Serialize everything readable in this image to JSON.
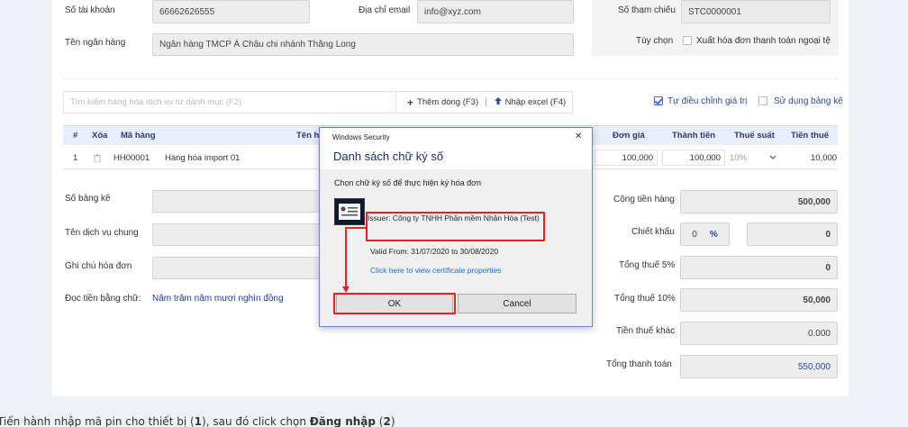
{
  "form": {
    "account_label": "Số tài khoản",
    "account_value": "66662626555",
    "email_label": "Địa chỉ email",
    "email_value": "info@xyz.com",
    "reference_label": "Số tham chiếu",
    "reference_value": "STC0000001",
    "bank_label": "Tên ngân hàng",
    "bank_value": "Ngân hàng TMCP Á Châu chi nhánh Thăng Long",
    "option_label": "Tùy chọn",
    "foreign_invoice_label": "Xuất hóa đơn thanh toán ngoại tệ"
  },
  "toolbar": {
    "search_placeholder": "Tìm kiếm hàng hóa dịch vụ từ danh mục (F2)",
    "add_row_label": "Thêm dòng (F3)",
    "separator": "|",
    "import_excel_label": "Nhập excel (F4)",
    "auto_adjust_label": "Tự điều chỉnh giá trị",
    "use_list_label": "Sử dụng bảng kê"
  },
  "table": {
    "headers": {
      "index": "#",
      "delete": "Xóa",
      "code": "Mã hàng",
      "name": "Tên hà",
      "unit_price": "Đơn giá",
      "amount": "Thành tiền",
      "tax_rate": "Thuế suất",
      "tax": "Tiền thuế"
    },
    "rows": [
      {
        "index": "1",
        "code": "HH00001",
        "name": "Hàng hóa import 01",
        "unit_price": "100,000",
        "amount": "100,000",
        "tax_rate": "10%",
        "tax": "10,000"
      }
    ]
  },
  "lower": {
    "list_no_label": "Số bảng kê",
    "service_name_label": "Tên dịch vụ chung",
    "invoice_note_label": "Ghi chú hóa đơn",
    "amount_words_label": "Đọc tiền bằng chữ:",
    "amount_words_value": "Năm trăm năm mươi nghìn đồng"
  },
  "totals": {
    "goods_label": "Cộng tiền hàng",
    "goods_value": "500,000",
    "discount_label": "Chiết khấu",
    "discount_pct": "0",
    "discount_pct_unit": "%",
    "discount_value": "0",
    "tax5_label": "Tổng thuế 5%",
    "tax5_value": "0",
    "tax10_label": "Tổng thuế 10%",
    "tax10_value": "50,000",
    "other_tax_label": "Tiền thuế khác",
    "other_tax_value": "0.000",
    "total_label": "Tổng thanh toán",
    "total_value": "550,000"
  },
  "dialog": {
    "window_title": "Windows Security",
    "close": "✕",
    "heading": "Danh sách chữ ký số",
    "instruction": "Chọn chữ ký số để thực hiện ký hóa đơn",
    "issuer": "Issuer: Công ty TNHH Phần mềm Nhân Hòa (Test)",
    "valid_from": "Valid From: 31/07/2020 to 30/08/2020",
    "cert_link": "Click here to view certificate properties",
    "ok_label": "OK",
    "cancel_label": "Cancel"
  },
  "caption": {
    "part1": "Tiến hành nhập mã pin cho thiết bị (",
    "num1": "1",
    "part2": "), sau đó click chọn ",
    "login": "Đăng nhập",
    "part3": " (",
    "num2": "2",
    "part4": ")"
  },
  "colors": {
    "accent": "#3a6ed8",
    "highlight": "#e02424",
    "total_value": "#2744d0"
  }
}
